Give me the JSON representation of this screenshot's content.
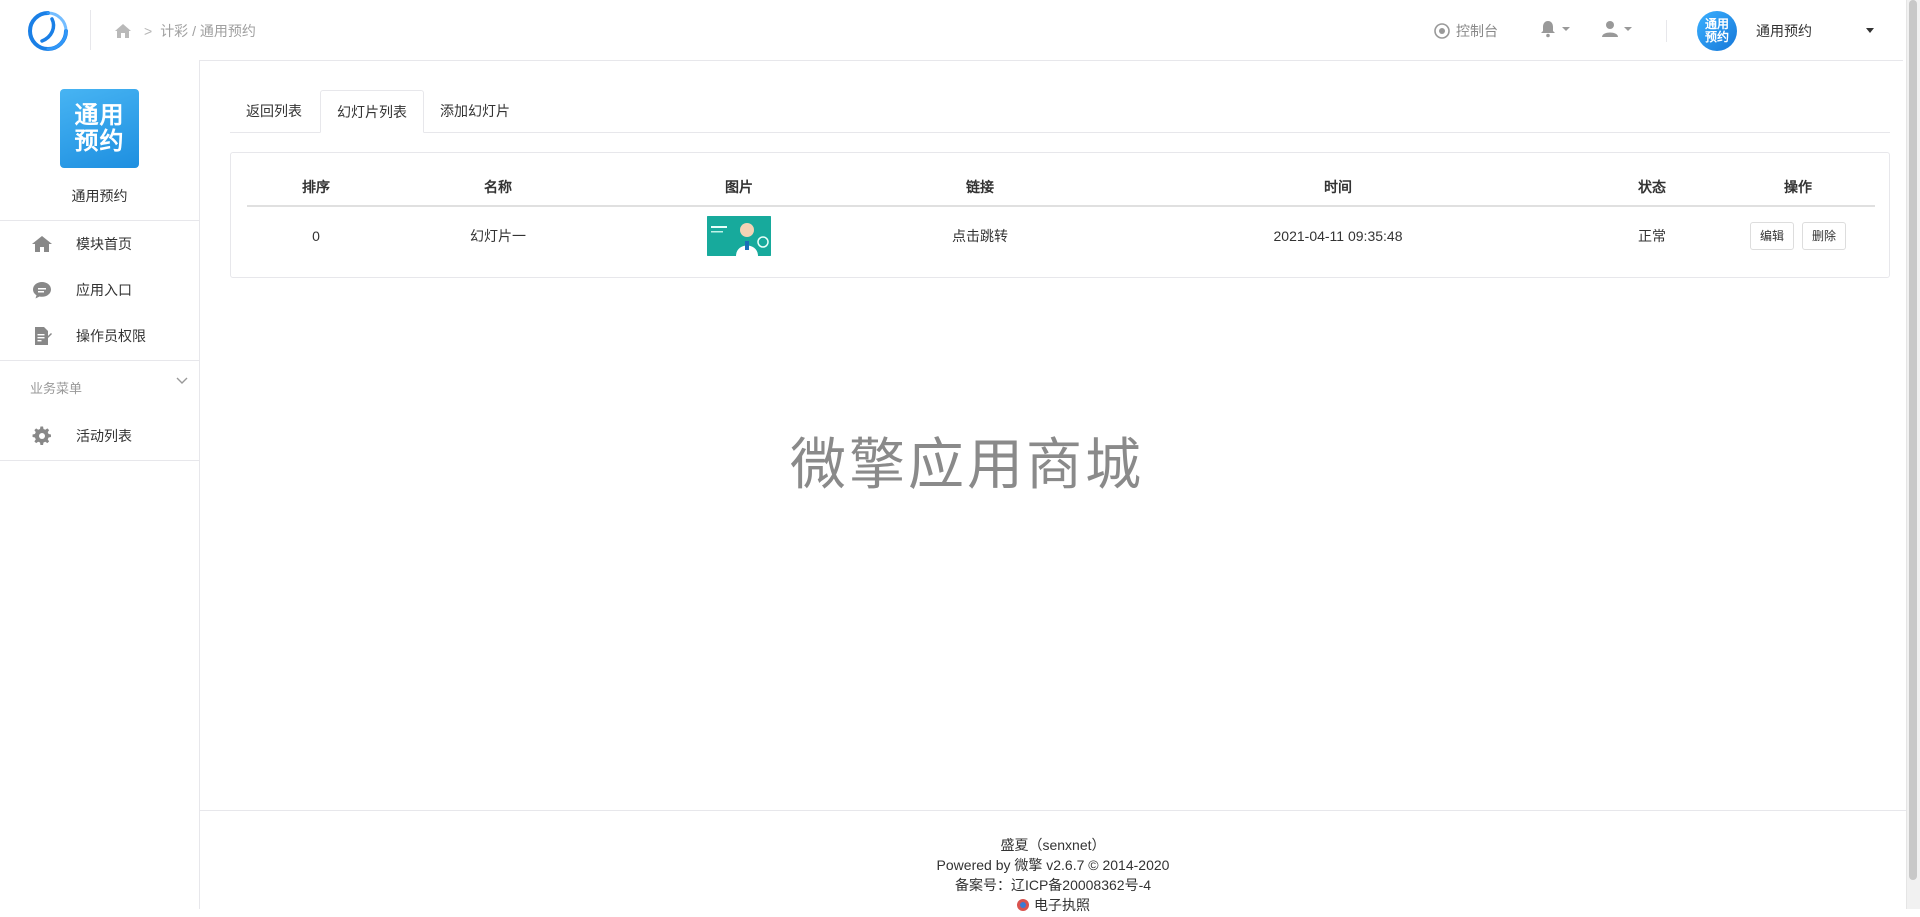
{
  "breadcrumb": {
    "path": "计彩 / 通用预约"
  },
  "topbar": {
    "console_label": "控制台",
    "account_avatar_text": "通用预约",
    "account_name": "通用预约"
  },
  "sidebar": {
    "app_logo_text": "通用预约",
    "app_name": "通用预约",
    "items": [
      {
        "label": "模块首页",
        "icon": "home-icon"
      },
      {
        "label": "应用入口",
        "icon": "chat-icon"
      },
      {
        "label": "操作员权限",
        "icon": "document-edit-icon"
      }
    ],
    "group_label": "业务菜单",
    "group_items": [
      {
        "label": "活动列表",
        "icon": "gear-icon"
      }
    ]
  },
  "tabs": [
    {
      "label": "返回列表",
      "active": false
    },
    {
      "label": "幻灯片列表",
      "active": true
    },
    {
      "label": "添加幻灯片",
      "active": false
    }
  ],
  "table": {
    "headers": [
      "排序",
      "名称",
      "图片",
      "链接",
      "时间",
      "状态",
      "操作"
    ],
    "rows": [
      {
        "order": "0",
        "name": "幻灯片一",
        "image": "thumbnail",
        "link": "点击跳转",
        "time": "2021-04-11 09:35:48",
        "status": "正常",
        "status_color": "#2ca400",
        "edit_label": "编辑",
        "delete_label": "删除"
      }
    ]
  },
  "watermark": "微擎应用商城",
  "footer": {
    "line1": "盛夏（senxnet）",
    "line2": "Powered by 微擎 v2.6.7 © 2014-2020",
    "line3": "备案号：辽ICP备20008362号-4",
    "line4": "电子执照"
  },
  "colors": {
    "accent": "#1e8fe0",
    "status_ok": "#2ca400"
  }
}
